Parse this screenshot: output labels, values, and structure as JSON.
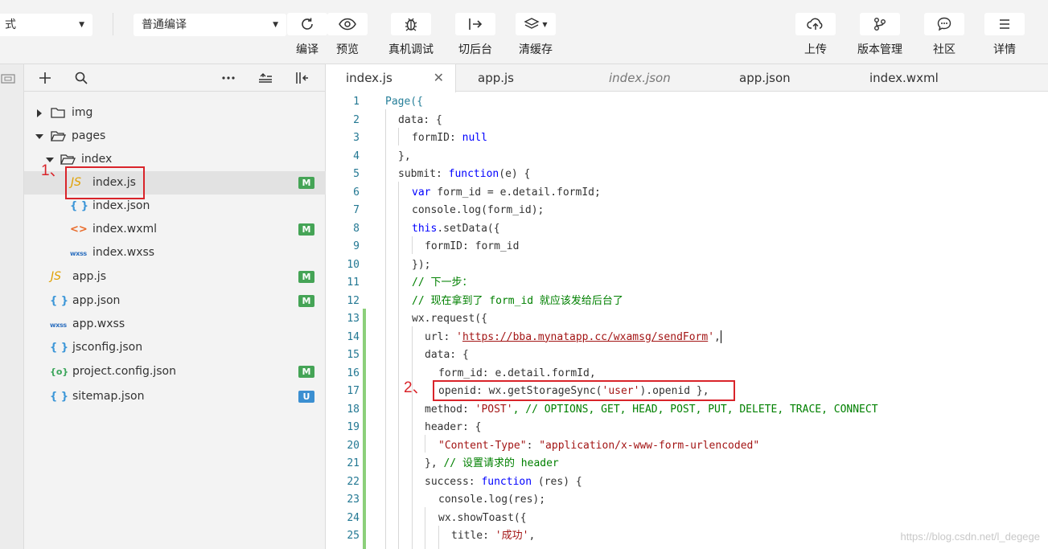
{
  "toolbar": {
    "mode_select": {
      "value": "式"
    },
    "compile_select": {
      "value": "普通编译"
    },
    "buttons": [
      {
        "label": "编译",
        "icon": "refresh-icon"
      },
      {
        "label": "预览",
        "icon": "eye-icon"
      },
      {
        "label": "真机调试",
        "icon": "bug-icon"
      },
      {
        "label": "切后台",
        "icon": "switch-background-icon"
      },
      {
        "label": "清缓存",
        "icon": "layers-icon"
      }
    ],
    "right_buttons": [
      {
        "label": "上传",
        "icon": "cloud-upload-icon"
      },
      {
        "label": "版本管理",
        "icon": "branch-icon"
      },
      {
        "label": "社区",
        "icon": "chat-icon"
      },
      {
        "label": "详情",
        "icon": "menu-icon"
      }
    ]
  },
  "file_tree": {
    "rows": [
      {
        "name": "img",
        "type": "folder",
        "expanded": false
      },
      {
        "name": "pages",
        "type": "folder",
        "expanded": true
      },
      {
        "name": "index",
        "type": "folder",
        "expanded": true
      },
      {
        "name": "index.js",
        "type": "js",
        "badge": "M",
        "selected": true
      },
      {
        "name": "index.json",
        "type": "json",
        "badge": ""
      },
      {
        "name": "index.wxml",
        "type": "wxml",
        "badge": "M"
      },
      {
        "name": "index.wxss",
        "type": "wxss",
        "badge": ""
      },
      {
        "name": "app.js",
        "type": "js",
        "badge": "M"
      },
      {
        "name": "app.json",
        "type": "json",
        "badge": "M"
      },
      {
        "name": "app.wxss",
        "type": "wxss",
        "badge": ""
      },
      {
        "name": "jsconfig.json",
        "type": "json",
        "badge": ""
      },
      {
        "name": "project.config.json",
        "type": "config",
        "badge": "M"
      },
      {
        "name": "sitemap.json",
        "type": "json",
        "badge": "U"
      }
    ],
    "icon_labels": {
      "js": "JS",
      "json": "{ }",
      "wxml": "<>",
      "wxss": "wxss",
      "config": "{o}"
    }
  },
  "tabs": [
    {
      "label": "index.js",
      "active": true
    },
    {
      "label": "app.js",
      "active": false
    },
    {
      "label": "index.json",
      "active": false,
      "preview": true
    },
    {
      "label": "app.json",
      "active": false
    },
    {
      "label": "index.wxml",
      "active": false
    }
  ],
  "code": {
    "line_numbers": [
      "1",
      "2",
      "3",
      "4",
      "5",
      "6",
      "7",
      "8",
      "9",
      "10",
      "11",
      "12",
      "13",
      "14",
      "15",
      "16",
      "17",
      "18",
      "19",
      "20",
      "21",
      "22",
      "23",
      "24",
      "25"
    ],
    "l1": {
      "a": "Page({"
    },
    "l2": {
      "a": "data: {"
    },
    "l3": {
      "a": "formID: ",
      "b": "null"
    },
    "l4": {
      "a": "},"
    },
    "l5": {
      "a": "submit: ",
      "b": "function",
      "c": "(e) {"
    },
    "l6": {
      "a": "var",
      "b": " form_id = e.detail.formId;"
    },
    "l7": {
      "a": "console.log(form_id);"
    },
    "l8": {
      "a": "this",
      "b": ".setData({"
    },
    "l9": {
      "a": "formID: form_id"
    },
    "l10": {
      "a": "});"
    },
    "l11": {
      "a": "// 下一步："
    },
    "l12": {
      "a": "// 现在拿到了 form_id 就应该发给后台了"
    },
    "l13": {
      "a": "wx.request({"
    },
    "l14": {
      "a": "url: ",
      "b": "'",
      "c": "https://bba.mynatapp.cc/wxamsg/sendForm",
      "d": "'",
      "e": ","
    },
    "l15": {
      "a": "data: {"
    },
    "l16": {
      "a": "form_id: e.detail.formId,"
    },
    "l17": {
      "a": "openid: wx.getStorageSync(",
      "b": "'user'",
      "c": ").openid },"
    },
    "l18": {
      "a": "method: ",
      "b": "'POST'",
      "c": ", // OPTIONS, GET, HEAD, POST, PUT, DELETE, TRACE, CONNECT"
    },
    "l19": {
      "a": "header: {"
    },
    "l20": {
      "a": "\"Content-Type\"",
      "b": ": ",
      "c": "\"application/x-www-form-urlencoded\""
    },
    "l21": {
      "a": "}, ",
      "b": "// 设置请求的 header"
    },
    "l22": {
      "a": "success: ",
      "b": "function",
      "c": " (res) {"
    },
    "l23": {
      "a": "console.log(res);"
    },
    "l24": {
      "a": "wx.showToast({"
    },
    "l25": {
      "a": "title: ",
      "b": "'成功'",
      "c": ","
    }
  },
  "annotations": {
    "one": "1、",
    "two": "2、"
  },
  "watermark": "https://blog.csdn.net/l_degege",
  "colors": {
    "annotation_red": "#d9242a",
    "badge_modified": "#45a456",
    "badge_untracked": "#3b8fd1",
    "gutter_modified": "#8ccf7a"
  }
}
